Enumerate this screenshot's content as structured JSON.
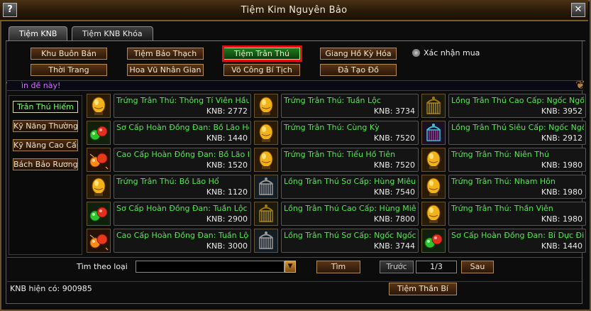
{
  "window": {
    "title": "Tiệm Kim Nguyên Bảo",
    "help_label": "?",
    "close_label": "✕"
  },
  "tabs": [
    {
      "label": "Tiệm KNB",
      "active": true
    },
    {
      "label": "Tiệm KNB Khóa",
      "active": false
    }
  ],
  "categories": [
    {
      "label": "Khu Buôn Bán",
      "selected": false
    },
    {
      "label": "Tiệm Bảo Thạch",
      "selected": false
    },
    {
      "label": "Tiệm Trân Thú",
      "selected": true
    },
    {
      "label": "Giang Hồ Kỳ Hóa",
      "selected": false
    },
    {
      "label": "Thời Trang",
      "selected": false
    },
    {
      "label": "Hoa Vũ Nhân Gian",
      "selected": false
    },
    {
      "label": "Võ Công Bí Tịch",
      "selected": false
    },
    {
      "label": "Đả Tạo Đồ",
      "selected": false
    }
  ],
  "confirm_purchase": {
    "label": "Xác nhận mua",
    "checked": false
  },
  "notice": "ìn đề này!",
  "sidebar": [
    {
      "label": "Trân Thú Hiếm",
      "selected": true
    },
    {
      "label": "Kỹ Năng Thường",
      "selected": false
    },
    {
      "label": "Kỹ Năng Cao Cấp",
      "selected": false
    },
    {
      "label": "Bách Bảo Rương",
      "selected": false
    }
  ],
  "items": [
    {
      "name": "Trứng Trân Thú: Thông Tí Viên Hầu",
      "price": "KNB: 2772",
      "icon": "egg-icon"
    },
    {
      "name": "Trứng Trân Thú: Tuần Lộc",
      "price": "KNB: 3734",
      "icon": "egg-icon"
    },
    {
      "name": "Lồng Trân Thú Cao Cấp: Ngốc Ngốc",
      "price": "KNB: 3952",
      "icon": "gold-cage-icon"
    },
    {
      "name": "Sơ Cấp Hoàn Đồng Đan: Bồ Lão Hổ",
      "price": "KNB: 1440",
      "icon": "green-pill-icon"
    },
    {
      "name": "Trứng Trân Thú: Cùng Kỳ",
      "price": "KNB: 7520",
      "icon": "egg-icon"
    },
    {
      "name": "Lồng Trân Thú Siêu Cấp: Ngốc Ngốc",
      "price": "KNB: 2912",
      "icon": "rainbow-cage-icon"
    },
    {
      "name": "Cao Cấp Hoàn Đồng Đan: Bồ Lão Hổ",
      "price": "KNB: 1520",
      "icon": "orange-pill-icon"
    },
    {
      "name": "Trứng Trân Thú: Tiểu Hồ Tiên",
      "price": "KNB: 7520",
      "icon": "egg-icon"
    },
    {
      "name": "Trứng Trân Thú: Niên Thú",
      "price": "KNB: 1980",
      "icon": "egg-icon"
    },
    {
      "name": "Trứng Trân Thú: Bồ Lão Hổ",
      "price": "KNB: 1120",
      "icon": "egg-icon"
    },
    {
      "name": "Lồng Trân Thú Sơ Cấp: Hùng Miêu",
      "price": "KNB: 7540",
      "icon": "silver-cage-icon"
    },
    {
      "name": "Trứng Trân Thú: Nham Hôn",
      "price": "KNB: 1980",
      "icon": "egg-icon"
    },
    {
      "name": "Sơ Cấp Hoàn Đồng Đan: Tuần Lộc",
      "price": "KNB: 2900",
      "icon": "green-pill-icon"
    },
    {
      "name": "Lồng Trân Thú Cao Cấp: Hùng Miêu",
      "price": "KNB: 7800",
      "icon": "gold-cage-icon"
    },
    {
      "name": "Trứng Trân Thú: Thần Viên",
      "price": "KNB: 1980",
      "icon": "egg-icon"
    },
    {
      "name": "Cao Cấp Hoàn Đồng Đan: Tuần Lộc",
      "price": "KNB: 3000",
      "icon": "orange-pill-icon"
    },
    {
      "name": "Lồng Trân Thú Sơ Cấp: Ngốc Ngốc N",
      "price": "KNB: 3744",
      "icon": "silver-cage-icon"
    },
    {
      "name": "Sơ Cấp Hoàn Đồng Đan: Bỉ Dực Điểu",
      "price": "KNB: 1440",
      "icon": "green-pill-icon"
    }
  ],
  "filter": {
    "label": "Tìm theo loại",
    "value": "",
    "arrow": "▼"
  },
  "search_button": "Tìm",
  "prev_button": "Trước",
  "page_indicator": "1/3",
  "next_button": "Sau",
  "balance": "KNB hiện có: 900985",
  "mystery_shop_button": "Tiệm Thần Bí"
}
